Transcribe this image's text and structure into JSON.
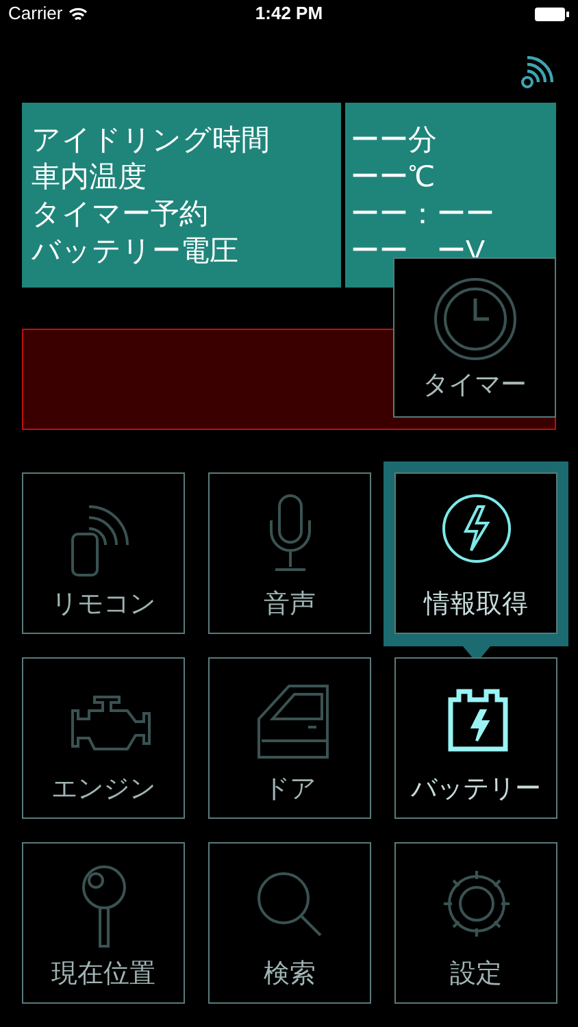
{
  "status_bar": {
    "carrier": "Carrier",
    "time": "1:42 PM"
  },
  "info": [
    {
      "label": "アイドリング時間",
      "value": "ーー分"
    },
    {
      "label": "車内温度",
      "value": "ーー℃"
    },
    {
      "label": "タイマー予約",
      "value": "ーー：ーー"
    },
    {
      "label": "バッテリー電圧",
      "value": "ーー　ーV"
    }
  ],
  "timer_button": {
    "label": "タイマー"
  },
  "tiles": [
    {
      "label": "リモコン",
      "selected": false,
      "active": false
    },
    {
      "label": "音声",
      "selected": false,
      "active": false
    },
    {
      "label": "情報取得",
      "selected": true,
      "active": true
    },
    {
      "label": "エンジン",
      "selected": false,
      "active": false
    },
    {
      "label": "ドア",
      "selected": false,
      "active": false
    },
    {
      "label": "バッテリー",
      "selected": false,
      "active": true
    },
    {
      "label": "現在位置",
      "selected": false,
      "active": false
    },
    {
      "label": "検索",
      "selected": false,
      "active": false
    },
    {
      "label": "設定",
      "selected": false,
      "active": false
    }
  ]
}
